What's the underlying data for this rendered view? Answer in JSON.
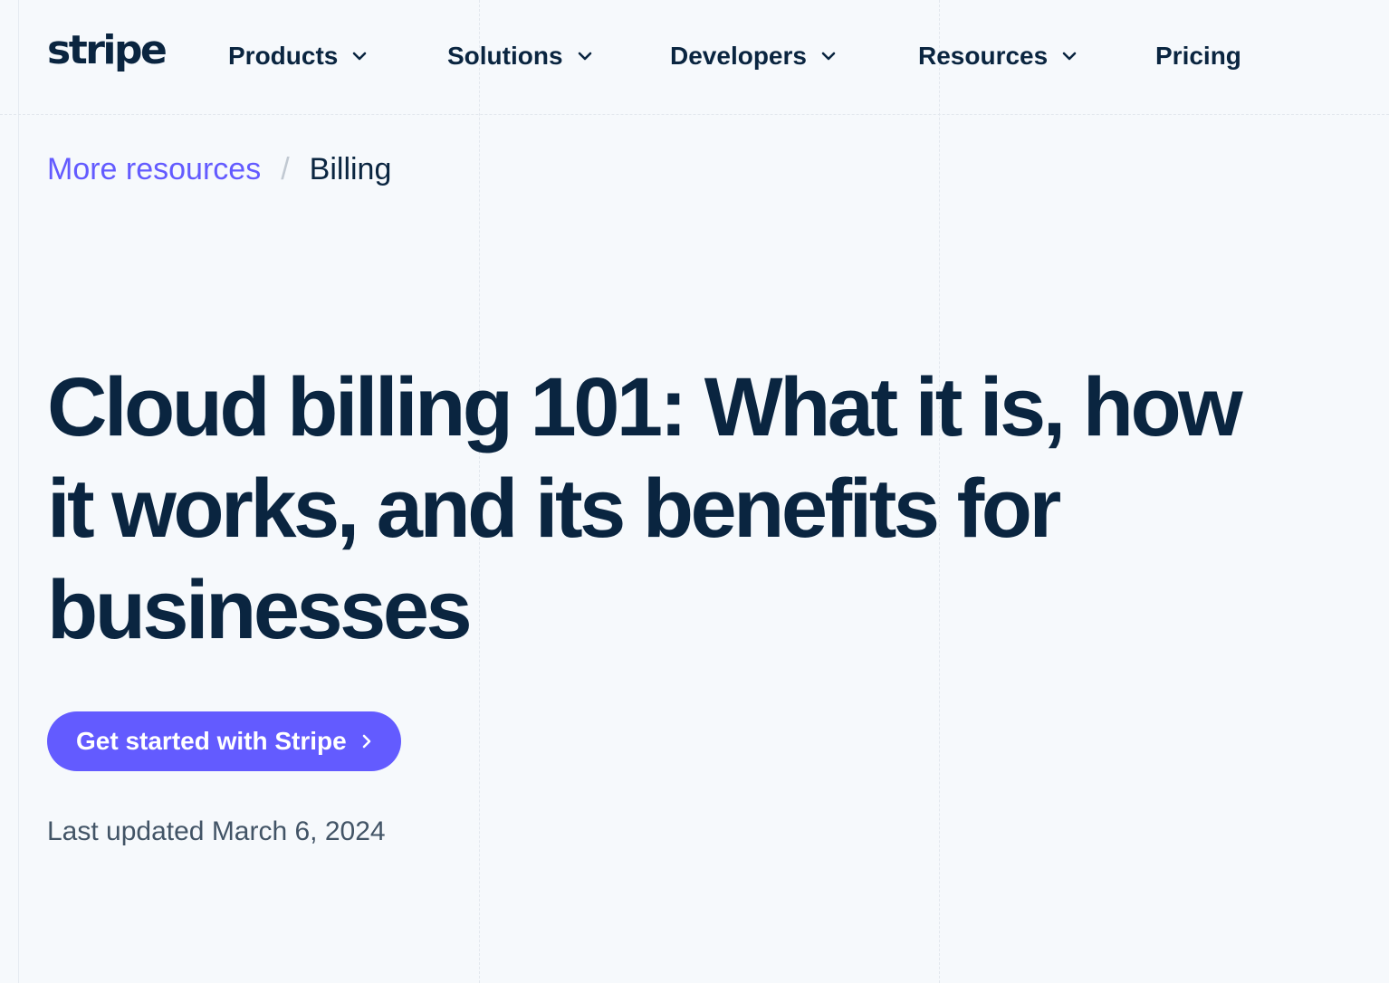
{
  "brand": {
    "logo_text": "stripe"
  },
  "nav": {
    "items": [
      {
        "label": "Products",
        "icon": "chevron-down-icon"
      },
      {
        "label": "Solutions",
        "icon": "chevron-down-icon"
      },
      {
        "label": "Developers",
        "icon": "chevron-down-icon"
      },
      {
        "label": "Resources",
        "icon": "chevron-down-icon"
      },
      {
        "label": "Pricing"
      }
    ]
  },
  "breadcrumb": {
    "parent": "More resources",
    "separator": "/",
    "current": "Billing"
  },
  "article": {
    "title": "Cloud billing 101: What it is, how it works, and its benefits for businesses",
    "cta_label": "Get started with Stripe",
    "cta_icon": "chevron-right-icon",
    "last_updated": "Last updated March 6, 2024"
  },
  "colors": {
    "background": "#f6f9fc",
    "text": "#0a2540",
    "accent": "#635bff",
    "muted": "#425466"
  }
}
